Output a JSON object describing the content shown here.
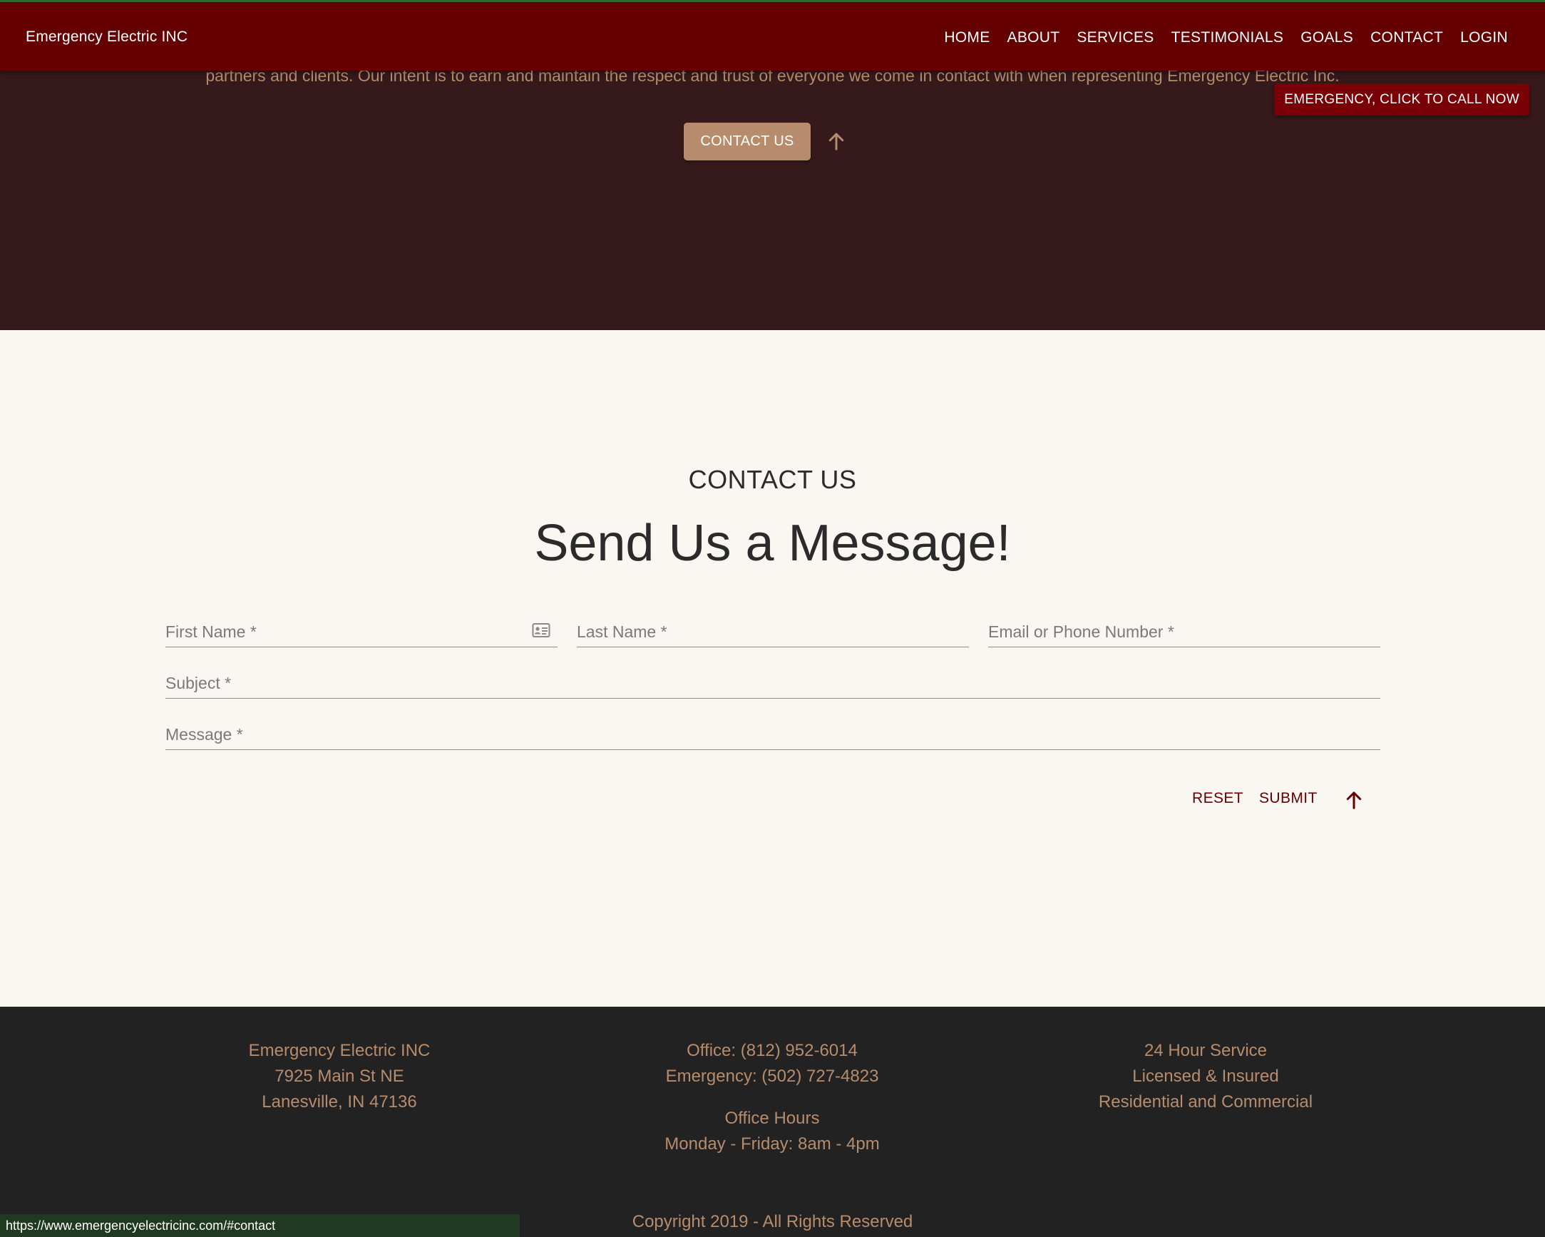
{
  "header": {
    "brand": "Emergency Electric INC",
    "nav": [
      "HOME",
      "ABOUT",
      "SERVICES",
      "TESTIMONIALS",
      "GOALS",
      "CONTACT",
      "LOGIN"
    ]
  },
  "hero": {
    "text": "partners and clients. Our intent is to earn and maintain the respect and trust of everyone we come in contact with when representing Emergency Electric Inc.",
    "contact_button": "CONTACT US"
  },
  "emergency_button": "EMERGENCY, CLICK TO CALL NOW",
  "contact": {
    "kicker": "CONTACT US",
    "heading": "Send Us a Message!",
    "fields": {
      "first_name": "First Name *",
      "last_name": "Last Name *",
      "email_phone": "Email or Phone Number *",
      "subject": "Subject *",
      "message": "Message *"
    },
    "reset": "RESET",
    "submit": "SUBMIT"
  },
  "footer": {
    "col1": [
      "Emergency Electric INC",
      "7925 Main St NE",
      "Lanesville, IN 47136"
    ],
    "col2": [
      "Office: (812) 952-6014",
      "Emergency: (502) 727-4823"
    ],
    "col2b": [
      "Office Hours",
      "Monday - Friday: 8am - 4pm"
    ],
    "col3": [
      "24 Hour Service",
      "Licensed & Insured",
      "Residential and Commercial"
    ],
    "copyright": "Copyright 2019 - All Rights Reserved"
  },
  "status_url": "https://www.emergencyelectricinc.com/#contact",
  "colors": {
    "header": "#650000",
    "hero": "#35191b",
    "accent": "#b78c6c",
    "footer": "#222222",
    "emergency": "#7a0008"
  },
  "icons": [
    "arrow-up-icon",
    "contact-card-icon"
  ]
}
